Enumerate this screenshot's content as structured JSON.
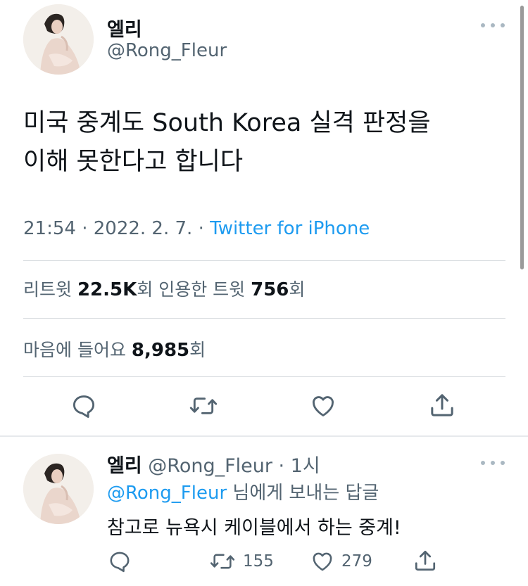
{
  "tweet": {
    "display_name": "엘리",
    "handle": "@Rong_Fleur",
    "text": "미국 중계도 South Korea 실격 판정을\n이해 못한다고 합니다",
    "time": "21:54",
    "sep1": " · ",
    "date": "2022. 2. 7.",
    "sep2": " · ",
    "source": "Twitter for iPhone",
    "retweets_label": "리트윗 ",
    "retweets": "22.5K",
    "retweets_unit": "회",
    "quotes_label": "  인용한 트윗 ",
    "quotes": "756",
    "quotes_unit": "회",
    "likes_label": "마음에 들어요 ",
    "likes": "8,985",
    "likes_unit": "회"
  },
  "reply": {
    "display_name": "엘리",
    "handle": " @Rong_Fleur",
    "time": " · 1시",
    "replying_mention": "@Rong_Fleur",
    "replying_suffix": " 님에게 보내는 답글",
    "text": "참고로 뉴욕시 케이블에서 하는 중계!",
    "retweet_count": "155",
    "like_count": "279"
  },
  "icons": {
    "reply": "comment-icon",
    "retweet": "retweet-icon",
    "like": "heart-icon",
    "share": "share-icon",
    "more": "more-dots-icon"
  },
  "colors": {
    "accent": "#1d9bf0",
    "secondary_text": "#536471",
    "primary_text": "#0f1419"
  }
}
